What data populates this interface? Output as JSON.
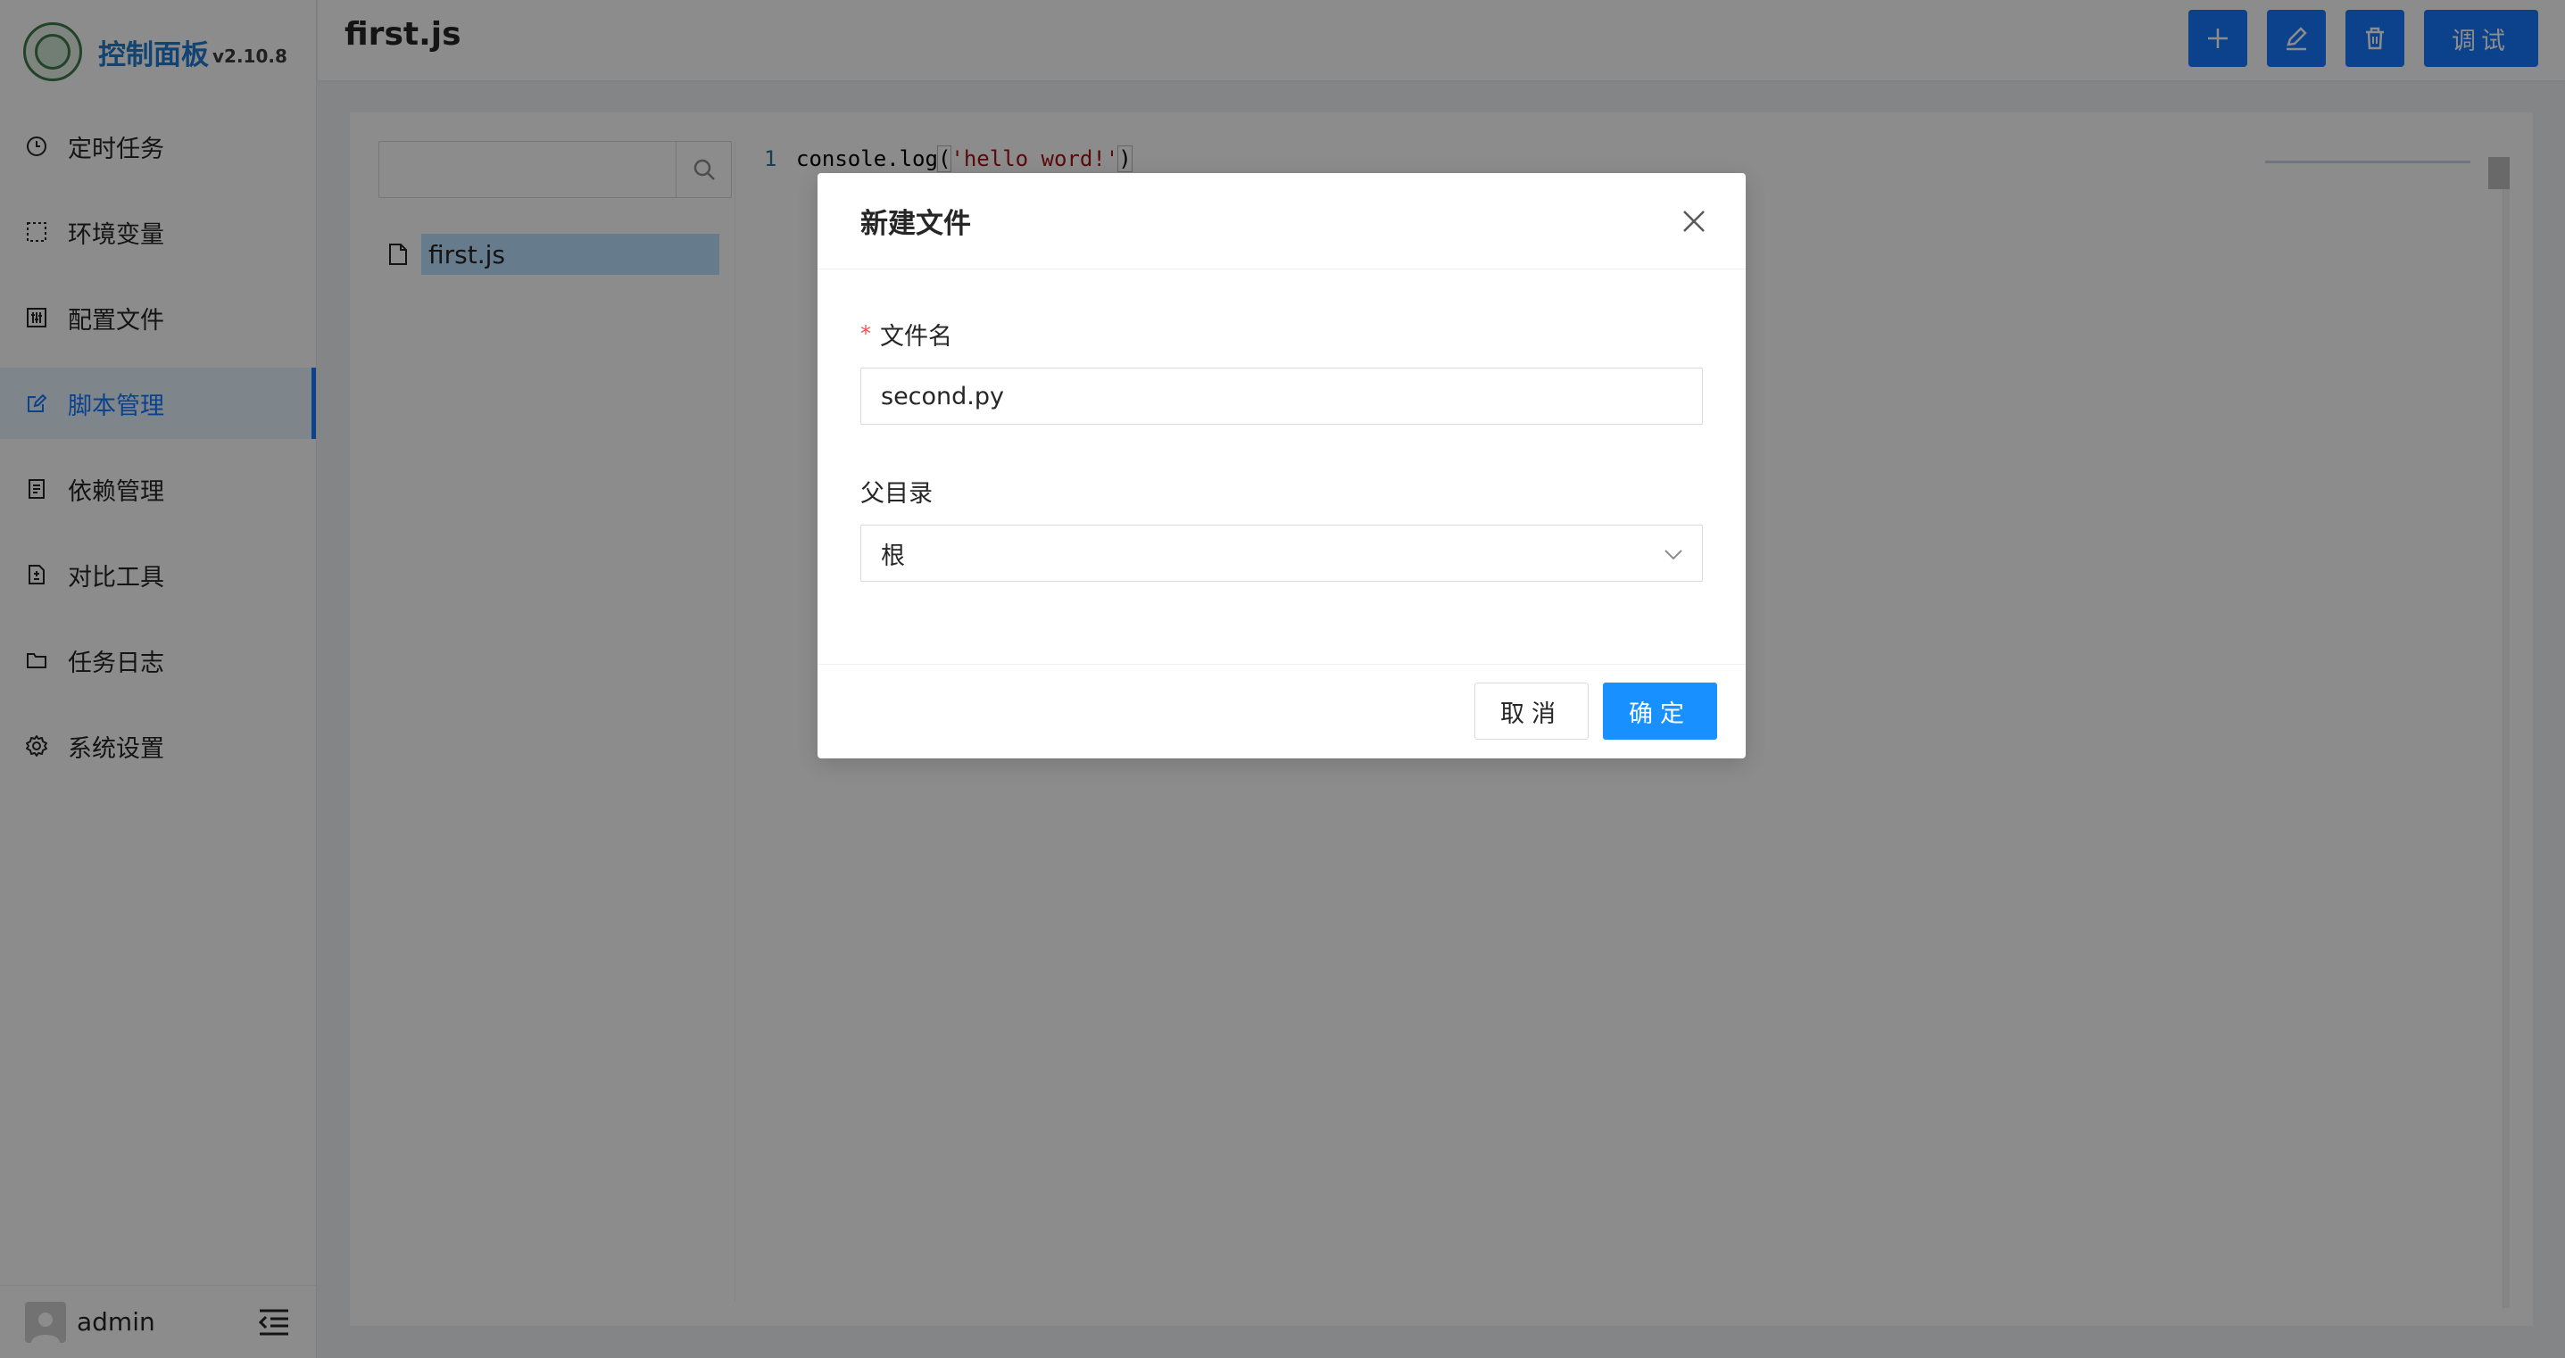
{
  "app": {
    "title": "控制面板",
    "version": "v2.10.8"
  },
  "sidebar": {
    "items": [
      {
        "label": "定时任务",
        "icon": "clock-icon",
        "active": false
      },
      {
        "label": "环境变量",
        "icon": "dashed-square-icon",
        "active": false
      },
      {
        "label": "配置文件",
        "icon": "sliders-icon",
        "active": false
      },
      {
        "label": "脚本管理",
        "icon": "edit-icon",
        "active": true
      },
      {
        "label": "依赖管理",
        "icon": "document-icon",
        "active": false
      },
      {
        "label": "对比工具",
        "icon": "diff-icon",
        "active": false
      },
      {
        "label": "任务日志",
        "icon": "folder-icon",
        "active": false
      },
      {
        "label": "系统设置",
        "icon": "gear-icon",
        "active": false
      }
    ],
    "user": {
      "name": "admin"
    }
  },
  "header": {
    "title": "first.js",
    "debug_label": "调试"
  },
  "tree": {
    "search_placeholder": "",
    "nodes": [
      {
        "label": "first.js",
        "selected": true
      }
    ]
  },
  "editor": {
    "lines": [
      {
        "no": "1",
        "fn": "console.log",
        "open": "(",
        "str": "'hello word!'",
        "close": ")"
      }
    ]
  },
  "modal": {
    "title": "新建文件",
    "filename_label": "文件名",
    "filename_value": "second.py",
    "parent_label": "父目录",
    "parent_value": "根",
    "cancel_label": "取消",
    "ok_label": "确定"
  },
  "colors": {
    "primary": "#1677ff",
    "brand_text": "#1f7bd1",
    "selected_bg": "#bae0ff",
    "required": "#ff4d4f"
  }
}
